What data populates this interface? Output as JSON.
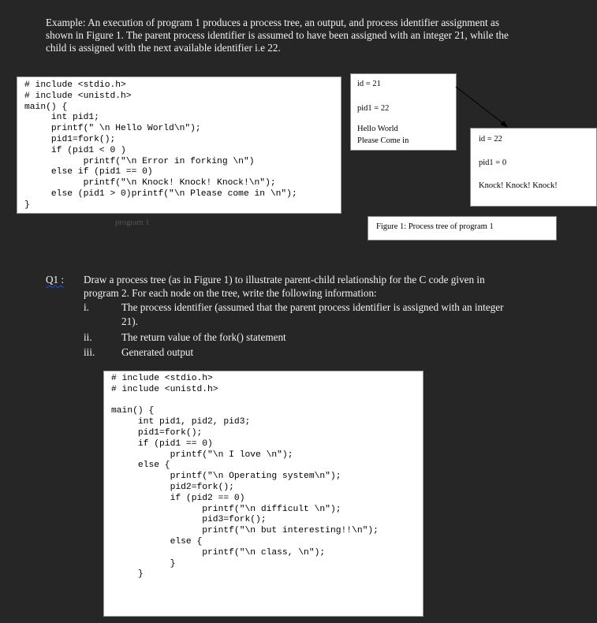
{
  "intro": {
    "line1": "Example:  An execution of program 1 produces a process tree, an output, and process identifier assignment as",
    "line2": "shown in Figure 1.   The parent process identifier is assumed to have been assigned with an integer 21, while the",
    "line3": "child is assigned with the next available identifier i.e 22."
  },
  "program1": {
    "lines": [
      "# include <stdio.h>",
      "# include <unistd.h>",
      "main() {",
      "     int pid1;",
      "     printf(\" \\n Hello World\\n\");",
      "     pid1=fork();",
      "     if (pid1 < 0 )",
      "           printf(\"\\n Error in forking \\n\")",
      "     else if (pid1 == 0)",
      "           printf(\"\\n Knock! Knock! Knock!\\n\");",
      "     else (pid1 > 0)printf(\"\\n Please come in \\n\");",
      "}"
    ],
    "label": "program 1"
  },
  "figure1": {
    "parent": {
      "id": "id = 21",
      "pid": "pid1 = 22",
      "output1": "Hello World",
      "output2": "Please Come in"
    },
    "child": {
      "id": "id = 22",
      "pid": "pid1 = 0",
      "output": "Knock! Knock! Knock!"
    },
    "caption": "Figure 1:  Process tree of program 1"
  },
  "question": {
    "number": "Q1 :",
    "text1": "Draw a process tree (as in Figure 1) to illustrate parent-child relationship for the C code given in",
    "text2": "program 2.  For each node on the tree, write the following information:",
    "items": [
      {
        "num": "i.",
        "line1": "The process identifier (assumed that the parent process identifier is assigned with an integer",
        "line2": "21)."
      },
      {
        "num": "ii.",
        "line1": "The return value of the fork() statement"
      },
      {
        "num": "iii.",
        "line1": "Generated output"
      }
    ]
  },
  "program2": {
    "lines": [
      "# include <stdio.h>",
      "# include <unistd.h>",
      "",
      "main() {",
      "     int pid1, pid2, pid3;",
      "     pid1=fork();",
      "     if (pid1 == 0)",
      "           printf(\"\\n I love \\n\");",
      "     else {",
      "           printf(\"\\n Operating system\\n\");",
      "           pid2=fork();",
      "           if (pid2 == 0)",
      "                 printf(\"\\n difficult \\n\");",
      "                 pid3=fork();",
      "                 printf(\"\\n but interesting!!\\n\");",
      "           else {",
      "                 printf(\"\\n class, \\n\");",
      "           }",
      "     }"
    ]
  }
}
